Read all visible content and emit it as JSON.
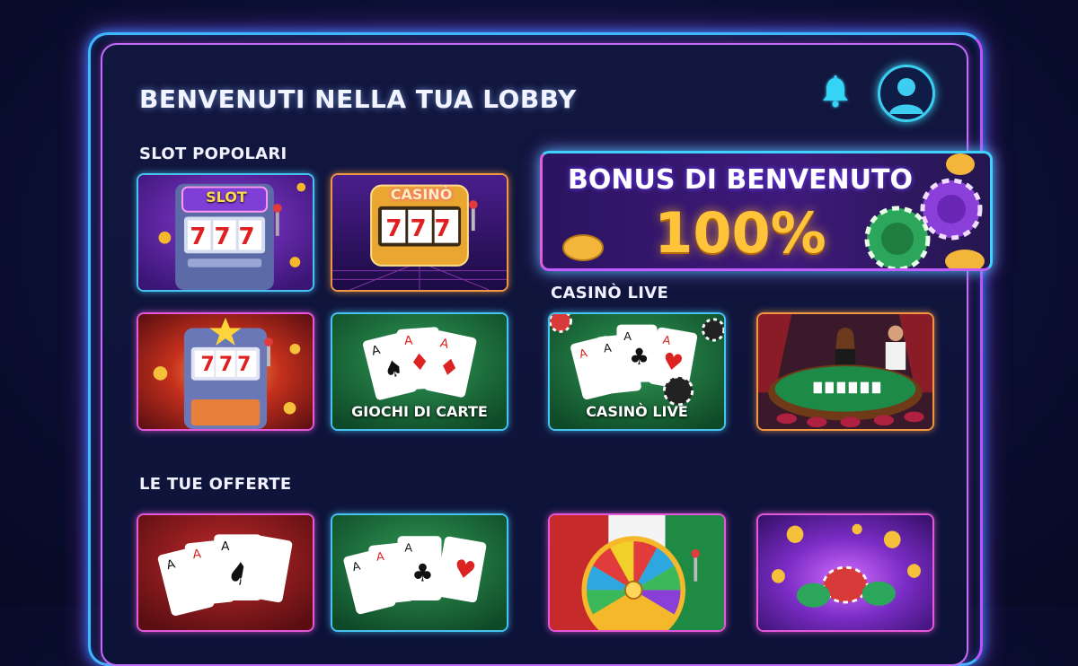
{
  "header": {
    "title": "BENVENUTI NELLA TUA LOBBY",
    "icons": [
      "bell-icon",
      "user-avatar-icon"
    ]
  },
  "sections": {
    "popular_slots": {
      "label": "SLOT POPOLARI"
    },
    "live_casino": {
      "label": "CASINÒ LIVE"
    },
    "offers": {
      "label": "LE TUE OFFERTE"
    }
  },
  "bonus": {
    "title": "BONUS DI BENVENUTO",
    "value": "100%"
  },
  "tiles": {
    "slot_classic": {
      "sign": "SLOT",
      "reels": "777"
    },
    "slot_casino": {
      "sign": "CASINÒ",
      "reels": "777"
    },
    "slot_stars": {
      "reels": "777"
    },
    "card_games": {
      "caption": "GIOCHI DI CARTE"
    },
    "live_cards": {
      "caption": "CASINÒ LIVE"
    }
  },
  "colors": {
    "accent_cyan": "#3fd2ff",
    "accent_pink": "#e458d9",
    "gold": "#ffc43a",
    "background": "#0b0f33"
  }
}
